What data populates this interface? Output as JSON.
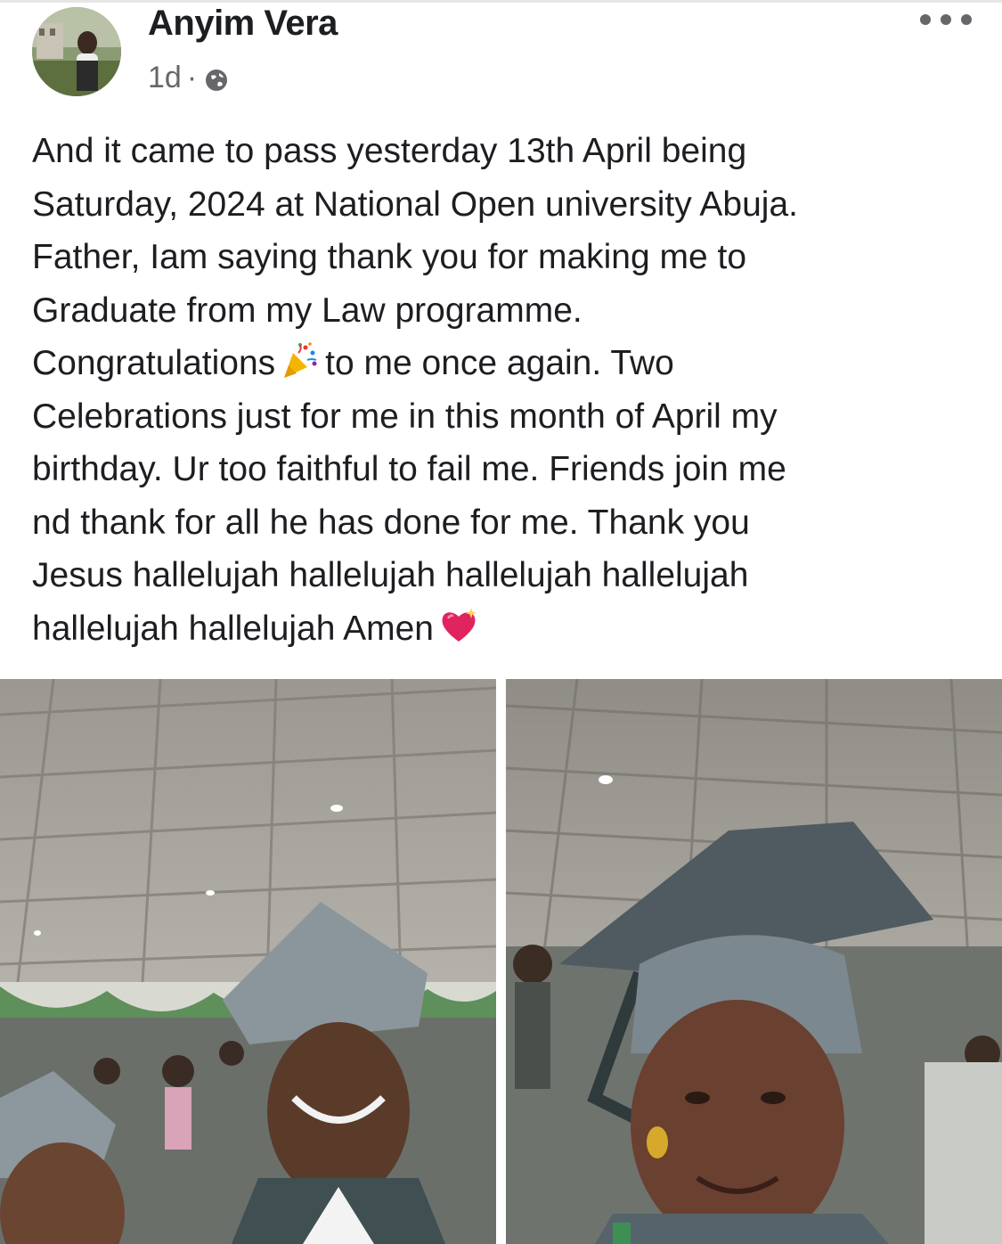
{
  "post": {
    "author": "Anyim Vera",
    "timestamp": "1d",
    "separator": "·",
    "privacy_icon": "globe-icon",
    "menu_icon": "more-dots-icon",
    "text_lines": [
      "And it came to pass yesterday 13th April being",
      "Saturday, 2024 at National Open university Abuja.",
      "Father, Iam saying thank you for making me to",
      "Graduate from my Law programme."
    ],
    "text_congrats_before": "Congratulations",
    "emoji_party": "party-popper-emoji",
    "text_congrats_after": "to me once again. Two",
    "text_lines_2": [
      "Celebrations just for me in this month of April my",
      "birthday. Ur too faithful to fail me. Friends join me",
      "nd thank for all he has done for me. Thank you",
      "Jesus hallelujah hallelujah hallelujah hallelujah"
    ],
    "text_last": "hallelujah hallelujah Amen",
    "emoji_heart": "sparkling-heart-emoji"
  },
  "photos": {
    "left": "graduation-photo-man",
    "right": "graduation-photo-woman"
  },
  "colors": {
    "text": "#1c1e21",
    "meta": "#65676b"
  }
}
